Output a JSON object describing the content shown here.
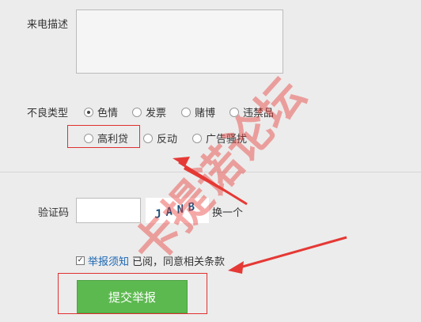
{
  "form": {
    "description_label": "来电描述",
    "description_value": "",
    "type_label": "不良类型",
    "type_options": [
      "色情",
      "发票",
      "赌博",
      "违禁品",
      "高利贷",
      "反动",
      "广告骚扰"
    ],
    "selected_type": "色情",
    "captcha_label": "验证码",
    "captcha_value": "",
    "captcha_text": "JANB",
    "refresh_captcha": "换一个",
    "agree_link": "举报须知",
    "agree_text": "已阅，同意相关条款",
    "agree_checked": true,
    "submit_label": "提交举报"
  },
  "watermark": {
    "text": "卡提诺论坛",
    "color": "#e8413b"
  },
  "colors": {
    "submit_bg": "#5cb94f",
    "highlight": "#e03030",
    "link": "#1a66b3"
  }
}
